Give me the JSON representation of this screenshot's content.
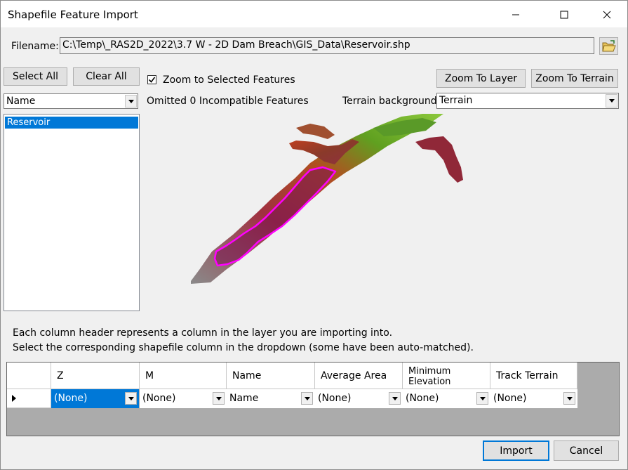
{
  "window": {
    "title": "Shapefile Feature Import",
    "minimize_icon": "minimize-icon",
    "maximize_icon": "maximize-icon",
    "close_icon": "close-icon"
  },
  "filename": {
    "label": "Filename:",
    "value": "C:\\Temp\\_RAS2D_2022\\3.7 W - 2D Dam Breach\\GIS_Data\\Reservoir.shp",
    "browse_icon": "folder-open-icon"
  },
  "selection": {
    "select_all_label": "Select All",
    "clear_all_label": "Clear All",
    "zoom_checkbox_label": "Zoom to Selected Features",
    "zoom_checked": true,
    "omitted_text": "Omitted 0 Incompatible Features"
  },
  "field_select": {
    "value": "Name"
  },
  "features": [
    {
      "label": "Reservoir",
      "selected": true
    }
  ],
  "map_tools": {
    "zoom_layer_label": "Zoom To Layer",
    "zoom_terrain_label": "Zoom To Terrain",
    "terrain_bg_label": "Terrain background:",
    "terrain_bg_value": "Terrain"
  },
  "instructions": {
    "line1": "Each column header represents a column in the layer you are importing into.",
    "line2": "Select the corresponding shapefile column in the dropdown (some have been auto-matched)."
  },
  "grid": {
    "columns": [
      {
        "header": "Z",
        "value": "(None)"
      },
      {
        "header": "M",
        "value": "(None)"
      },
      {
        "header": "Name",
        "value": "Name"
      },
      {
        "header": "Average Area",
        "value": "(None)"
      },
      {
        "header_line1": "Minimum",
        "header_line2": "Elevation",
        "value": "(None)"
      },
      {
        "header": "Track Terrain",
        "value": "(None)"
      }
    ],
    "row_indicator_icon": "row-pointer-icon"
  },
  "footer": {
    "import_label": "Import",
    "cancel_label": "Cancel"
  },
  "colors": {
    "accent": "#0078d7",
    "outline": "#ff00ff"
  }
}
